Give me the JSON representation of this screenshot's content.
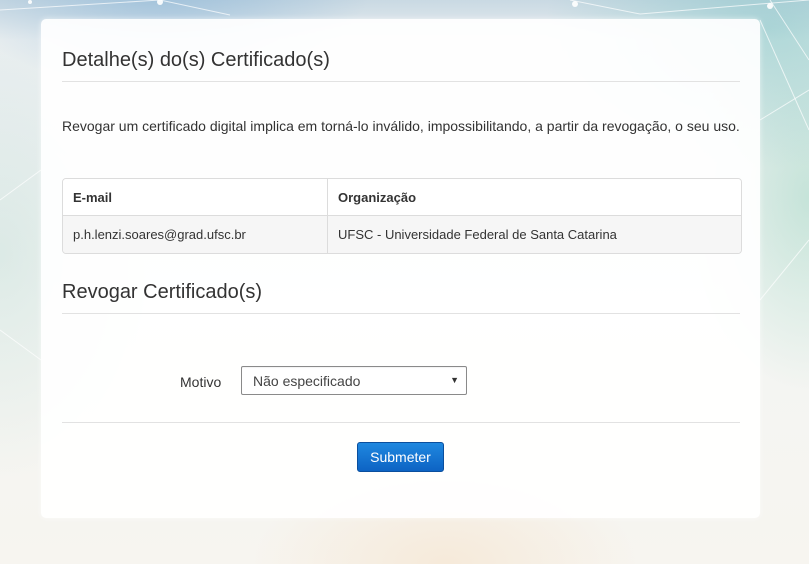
{
  "details": {
    "title": "Detalhe(s) do(s) Certificado(s)",
    "description": "Revogar um certificado digital implica em torná-lo inválido, impossibilitando, a partir da revogação, o seu uso.",
    "table": {
      "headers": [
        "E-mail",
        "Organização"
      ],
      "rows": [
        [
          "p.h.lenzi.soares@grad.ufsc.br",
          "UFSC - Universidade Federal de Santa Catarina"
        ]
      ]
    }
  },
  "revoke": {
    "title": "Revogar Certificado(s)",
    "motivo_label": "Motivo",
    "motivo_selected": "Não especificado",
    "submit_label": "Submeter"
  },
  "colors": {
    "primary_button": "#0d63c4",
    "text": "#333333"
  }
}
